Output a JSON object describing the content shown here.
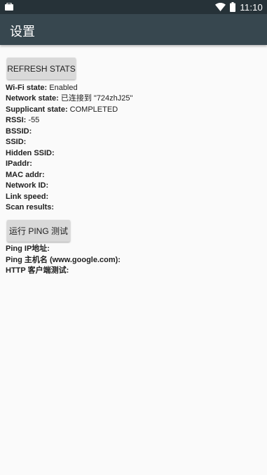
{
  "status_bar": {
    "time": "11:10",
    "left_icon": "notification-icon",
    "wifi_icon": "wifi-icon",
    "battery_icon": "battery-icon"
  },
  "app_bar": {
    "title": "设置"
  },
  "buttons": {
    "refresh": "REFRESH STATS",
    "ping": "运行 PING 测试"
  },
  "wifi_info": [
    {
      "label": "Wi-Fi state:",
      "value": " Enabled"
    },
    {
      "label": "Network state:",
      "value": " 已连接到 \"724zhJ25\""
    },
    {
      "label": "Supplicant state:",
      "value": " COMPLETED"
    },
    {
      "label": "RSSI:",
      "value": " -55"
    },
    {
      "label": "BSSID:",
      "value": ""
    },
    {
      "label": "SSID:",
      "value": ""
    },
    {
      "label": "Hidden SSID:",
      "value": ""
    },
    {
      "label": "IPaddr:",
      "value": ""
    },
    {
      "label": "MAC addr:",
      "value": ""
    },
    {
      "label": "Network ID:",
      "value": ""
    },
    {
      "label": "Link speed:",
      "value": ""
    },
    {
      "label": "Scan results:",
      "value": ""
    }
  ],
  "ping_info": [
    {
      "label": "Ping IP地址:",
      "value": ""
    },
    {
      "label": "Ping 主机名 (www.google.com):",
      "value": ""
    },
    {
      "label": "HTTP 客户端测试:",
      "value": ""
    }
  ],
  "colors": {
    "status_bar": "#263238",
    "app_bar": "#37474f",
    "background": "#fafafa",
    "button": "#d9d9d9"
  }
}
